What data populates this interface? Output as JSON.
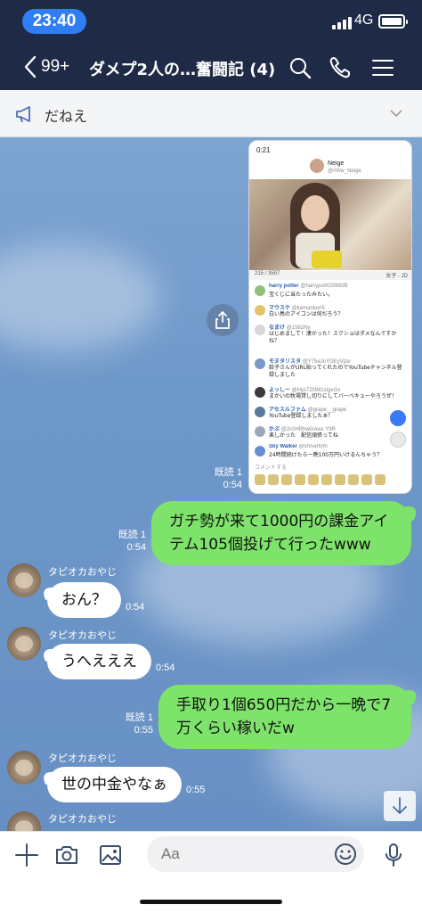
{
  "status": {
    "time": "23:40",
    "network": "4G"
  },
  "header": {
    "back_count": "99+",
    "title": "ダメプ2人の…奮闘記 (4)"
  },
  "announcement": {
    "text": "だねえ"
  },
  "shared_screenshot": {
    "status_time": "0:21",
    "profile_name": "Neige",
    "profile_handle": "@mhw_Neige",
    "viewer_stats": "215 / 3597",
    "stats_right": "女子 · JD",
    "comments": [
      {
        "name": "harry potter",
        "handle": "@harrypo00208839",
        "text": "宝くじに当たったみたい。"
      },
      {
        "name": "マウスケ",
        "handle": "@kemankon5",
        "text": "白い鳥のアイコンは何だろう？"
      },
      {
        "name": "なまけ",
        "handle": "@1562Ny",
        "text": "はじめまして！凄かった！スクショはダメなんですかね？"
      },
      {
        "name": "モヌタリスタ",
        "handle": "@Y75eJoYGEyVjze",
        "text": "餃子さんがURL貼ってくれたのでYouTubeチャンネル登録しました"
      },
      {
        "name": "よっしー",
        "handle": "@Hyx7ZNM1xtgxGx",
        "text": "まかいの牧場貸し切りにしてバーベキューやろうぜ！"
      },
      {
        "name": "アセスルファム",
        "handle": "@grape__grape",
        "text": "YouTube登録しましたぁ！"
      },
      {
        "name": "かぶ",
        "handle": "@2c0HRhwGAws Y9R",
        "text": "楽しかった　配信頑張ってね"
      },
      {
        "name": "Sky Walker",
        "handle": "@shivartom",
        "text": "24時間続けたら一晩100万円いけるんちゃう？"
      }
    ],
    "comment_placeholder": "コメントする"
  },
  "messages": {
    "receipt_1": "既読 1",
    "time_1": "0:54",
    "out_1": "ガチ勢が来て1000円の課金アイテム105個投げて行ったwww",
    "receipt_2": "既読 1",
    "time_2": "0:54",
    "sender_1": "タピオカおやじ",
    "in_1": "おん？",
    "time_3": "0:54",
    "sender_2": "タピオカおやじ",
    "in_2": "うへえええ",
    "time_4": "0:54",
    "out_2": "手取り1個650円だから一晩で7万くらい稼いだw",
    "receipt_3": "既読 1",
    "time_5": "0:55",
    "sender_3": "タピオカおやじ",
    "in_3": "世の中金やなぁ",
    "time_6": "0:55",
    "sender_4": "タピオカおやじ"
  },
  "input": {
    "placeholder": "Aa"
  },
  "colors": {
    "header_bg": "#1f2b46",
    "outgoing_bubble": "#7ee36a",
    "chat_bg": "#6d97c9",
    "time_pill": "#2f7ef6"
  },
  "icons": [
    "back-chevron-icon",
    "search-icon",
    "phone-icon",
    "menu-icon",
    "megaphone-icon",
    "chevron-down-icon",
    "share-icon",
    "arrow-down-icon",
    "plus-icon",
    "camera-icon",
    "image-icon",
    "emoji-icon",
    "microphone-icon"
  ]
}
